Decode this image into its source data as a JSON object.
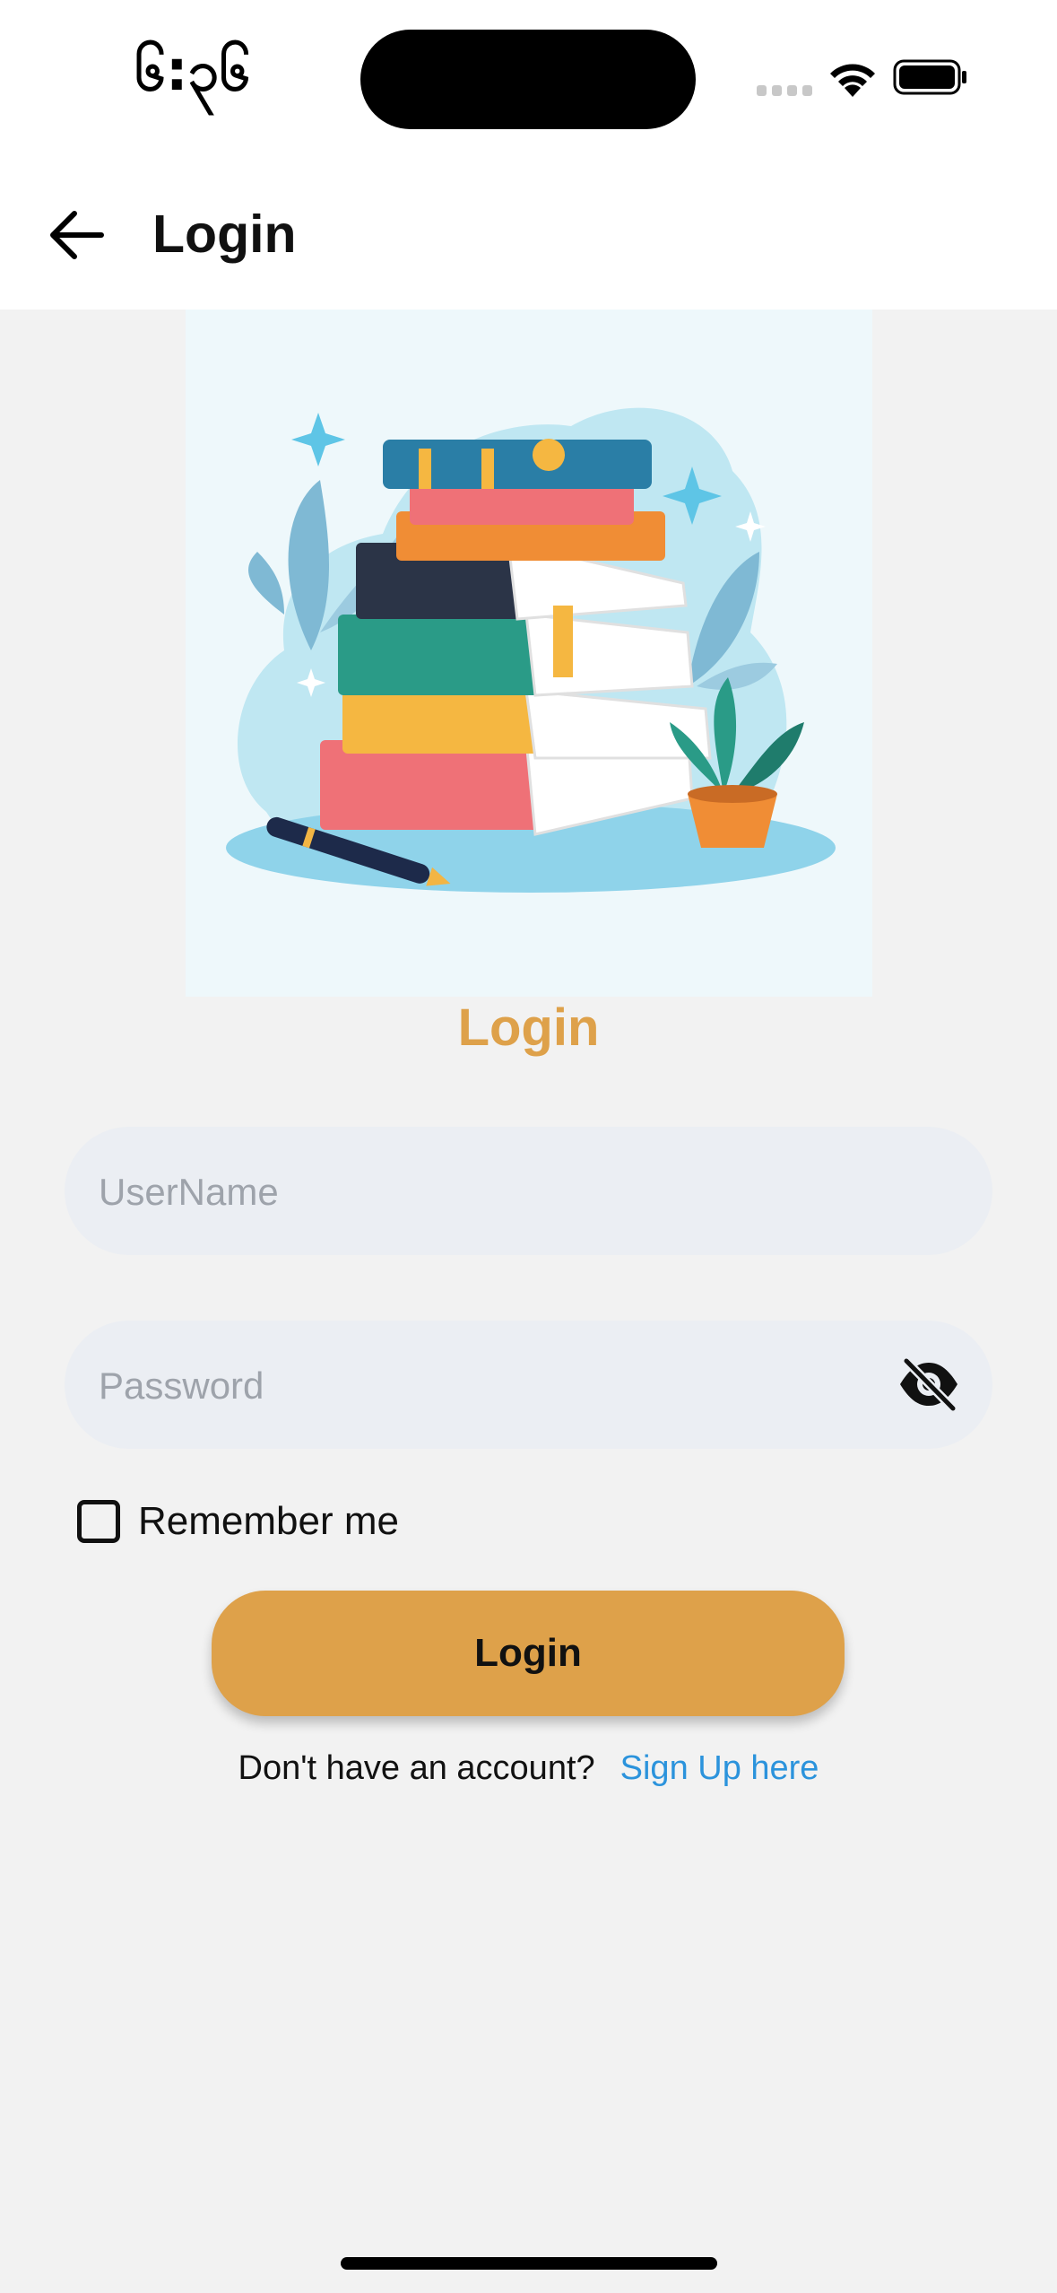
{
  "status_bar": {
    "time": "၆:၃၆",
    "icons": [
      "signal-icon",
      "wifi-icon",
      "battery-icon"
    ]
  },
  "app_bar": {
    "back_icon": "arrow-left-icon",
    "title": "Login"
  },
  "hero": {
    "illustration": "book-stack-illustration"
  },
  "form": {
    "heading": "Login",
    "username_placeholder": "UserName",
    "password_placeholder": "Password",
    "password_toggle_icon": "eye-off-icon",
    "remember_label": "Remember me",
    "submit_label": "Login"
  },
  "footer": {
    "prompt": "Don't have an account?",
    "signup_link": "Sign Up here"
  },
  "colors": {
    "accent": "#dea14a",
    "link": "#2b93dc",
    "field_bg": "#ebeef3",
    "page_bg": "#f2f2f2"
  }
}
